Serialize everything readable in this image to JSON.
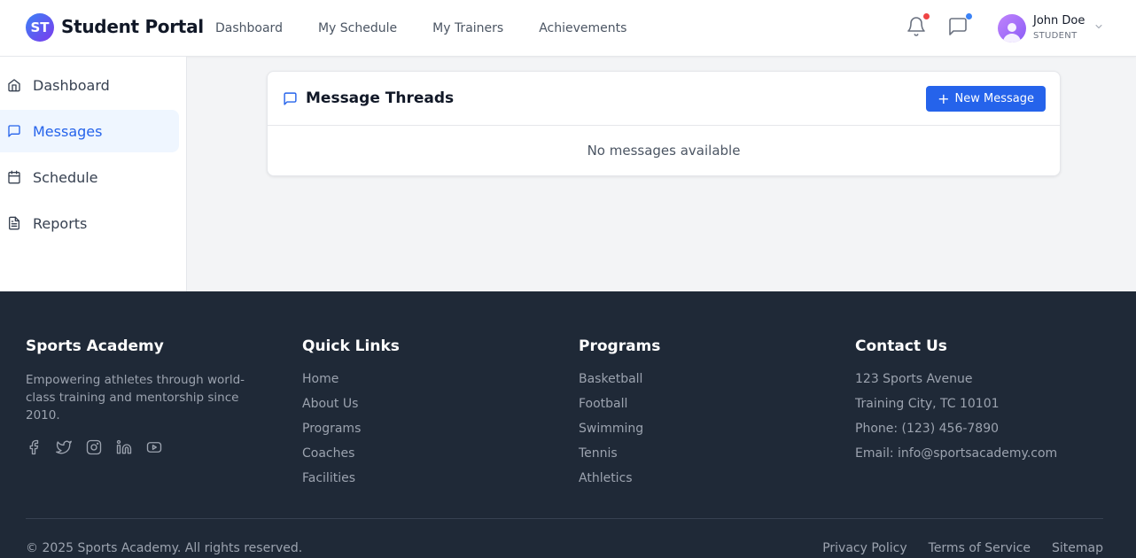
{
  "header": {
    "logo_initials": "ST",
    "brand": "Student Portal",
    "nav": [
      "Dashboard",
      "My Schedule",
      "My Trainers",
      "Achievements"
    ],
    "notification_dot_color": "#ef4444",
    "message_dot_color": "#3b82f6",
    "user": {
      "name": "John Doe",
      "role": "STUDENT"
    }
  },
  "sidebar": {
    "items": [
      {
        "label": "Dashboard",
        "icon": "home-icon",
        "active": false
      },
      {
        "label": "Messages",
        "icon": "message-icon",
        "active": true
      },
      {
        "label": "Schedule",
        "icon": "calendar-icon",
        "active": false
      },
      {
        "label": "Reports",
        "icon": "document-icon",
        "active": false
      }
    ]
  },
  "main": {
    "card_title": "Message Threads",
    "new_button_label": "New Message",
    "empty_text": "No messages available"
  },
  "footer": {
    "about": {
      "title": "Sports Academy",
      "description": "Empowering athletes through world-class training and mentorship since 2010.",
      "socials": [
        "facebook-icon",
        "twitter-icon",
        "instagram-icon",
        "linkedin-icon",
        "youtube-icon"
      ]
    },
    "quick_links": {
      "title": "Quick Links",
      "items": [
        "Home",
        "About Us",
        "Programs",
        "Coaches",
        "Facilities"
      ]
    },
    "programs": {
      "title": "Programs",
      "items": [
        "Basketball",
        "Football",
        "Swimming",
        "Tennis",
        "Athletics"
      ]
    },
    "contact": {
      "title": "Contact Us",
      "items": [
        "123 Sports Avenue",
        "Training City, TC 10101",
        "Phone: (123) 456-7890",
        "Email: info@sportsacademy.com"
      ]
    },
    "copyright": "© 2025 Sports Academy. All rights reserved.",
    "legal": [
      "Privacy Policy",
      "Terms of Service",
      "Sitemap"
    ]
  },
  "colors": {
    "primary": "#2563eb",
    "footer_bg": "#1f2937",
    "page_bg": "#f3f4f6"
  }
}
